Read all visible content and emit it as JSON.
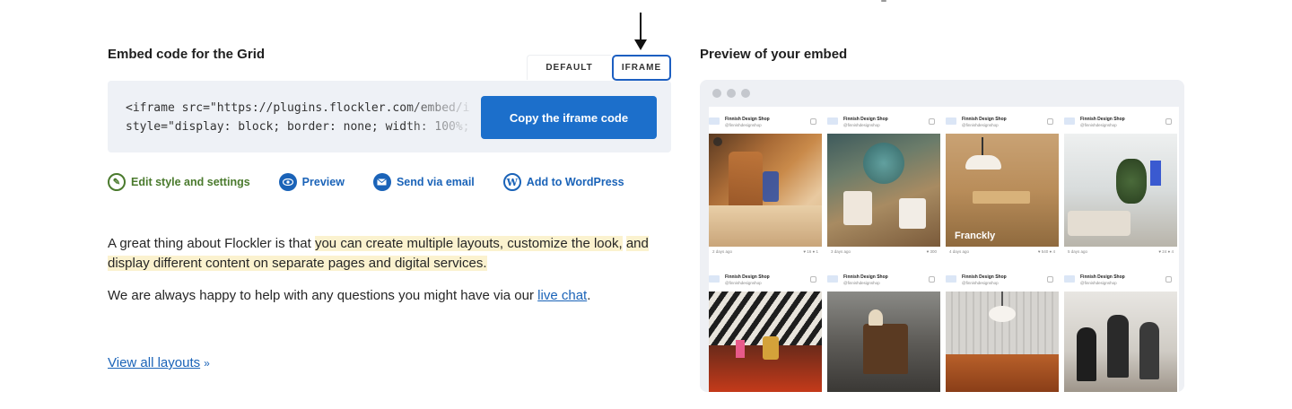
{
  "left": {
    "title": "Embed code for the Grid",
    "tabs": {
      "default": "DEFAULT",
      "iframe": "IFRAME"
    },
    "code_line1": "<iframe src=\"https://plugins.flockler.com/embed/i",
    "code_line2": "style=\"display: block; border: none; width: 100%;",
    "copy_button": "Copy the iframe code",
    "actions": {
      "edit": "Edit style and settings",
      "preview": "Preview",
      "email": "Send via email",
      "wordpress": "Add to WordPress"
    },
    "para1_plain": "A great thing about Flockler is that ",
    "para1_highlight_a": "you can create multiple layouts, customize the look,",
    "para1_highlight_b": "and display different content on separate pages and digital services.",
    "para2_text": "We are always happy to help with any questions you might have via our ",
    "para2_link": "live chat",
    "para2_end": ".",
    "view_all": "View all layouts",
    "view_all_chevron": "»"
  },
  "right": {
    "title": "Preview of your embed",
    "cards": [
      {
        "name": "Finnish Design Shop",
        "handle": "@finnishdesignshop",
        "time": "2 days ago",
        "stats": "♥ 16  ● 1"
      },
      {
        "name": "Finnish Design Shop",
        "handle": "@finnishdesignshop",
        "time": "3 days ago",
        "stats": "♥ 300"
      },
      {
        "name": "Finnish Design Shop",
        "handle": "@finnishdesignshop",
        "time": "4 days ago",
        "stats": "♥ 540  ● 4",
        "brand": "Franckly"
      },
      {
        "name": "Finnish Design Shop",
        "handle": "@finnishdesignshop",
        "time": "5 days ago",
        "stats": "♥ 24  ● 4"
      },
      {
        "name": "Finnish Design Shop",
        "handle": "@finnishdesignshop"
      },
      {
        "name": "Finnish Design Shop",
        "handle": "@finnishdesignshop"
      },
      {
        "name": "Finnish Design Shop",
        "handle": "@finnishdesignshop"
      },
      {
        "name": "Finnish Design Shop",
        "handle": "@finnishdesignshop"
      }
    ]
  },
  "colors": {
    "accent": "#1c6fcb",
    "link": "#1a63b8",
    "edit_green": "#4a7a2d",
    "highlight": "#fbf2cf",
    "code_bg": "#eef1f6"
  },
  "icons": {
    "edit": "palette-icon",
    "preview": "eye-icon",
    "email": "envelope-icon",
    "wordpress": "wordpress-icon",
    "arrow": "down-arrow-icon"
  }
}
